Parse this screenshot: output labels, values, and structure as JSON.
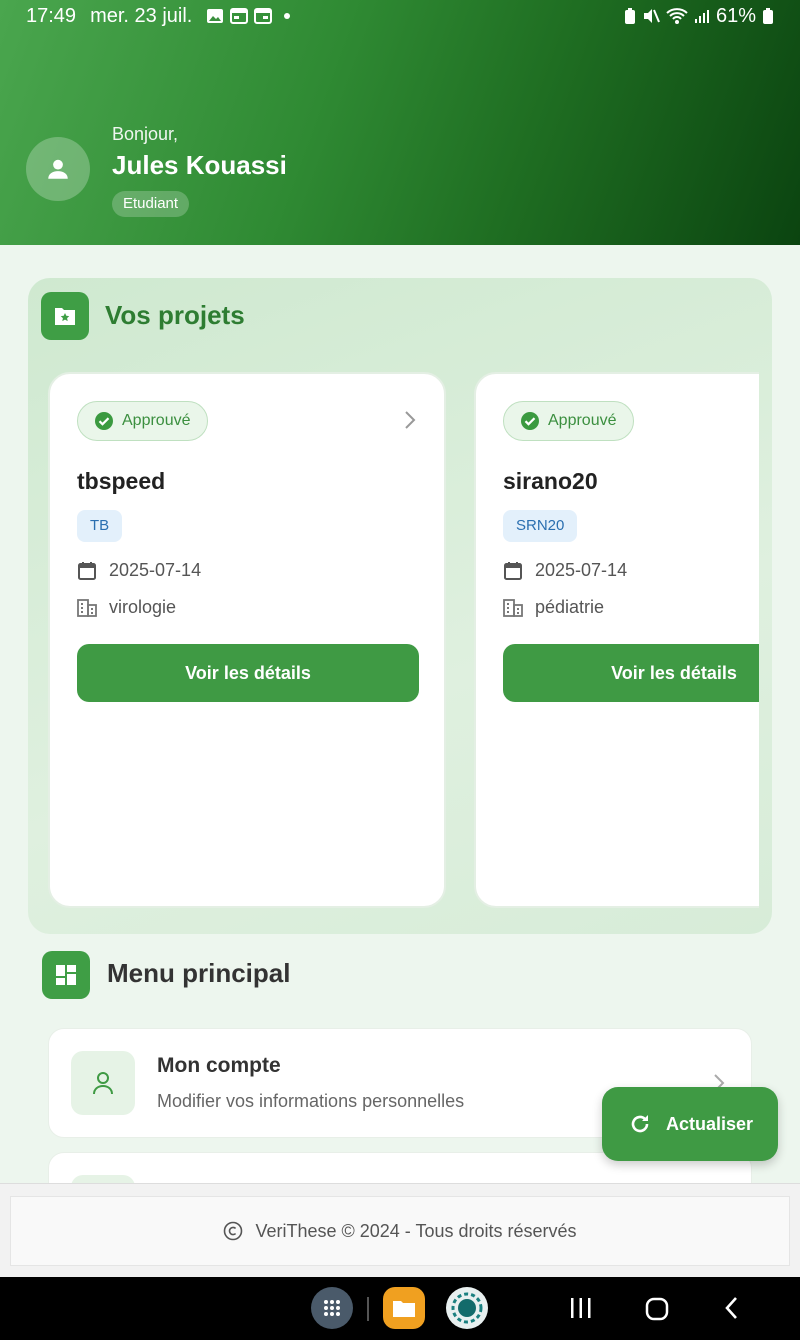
{
  "status_bar": {
    "time": "17:49",
    "date": "mer. 23 juil.",
    "battery": "61%"
  },
  "header": {
    "greeting": "Bonjour,",
    "user_name": "Jules Kouassi",
    "role": "Etudiant"
  },
  "projects": {
    "title": "Vos projets",
    "items": [
      {
        "status": "Approuvé",
        "name": "tbspeed",
        "code": "TB",
        "date": "2025-07-14",
        "department": "virologie",
        "button": "Voir les détails"
      },
      {
        "status": "Approuvé",
        "name": "sirano20",
        "code": "SRN20",
        "date": "2025-07-14",
        "department": "pédiatrie",
        "button": "Voir les détails"
      }
    ]
  },
  "menu": {
    "title": "Menu principal",
    "items": [
      {
        "title": "Mon compte",
        "subtitle": "Modifier vos informations personnelles"
      }
    ]
  },
  "fab": {
    "label": "Actualiser"
  },
  "footer": {
    "text": "VeriThese © 2024 - Tous droits réservés"
  },
  "colors": {
    "primary": "#3f9a44",
    "primary_dark": "#0b4410",
    "status_green": "#3b8f3f",
    "code_blue": "#2a6fb0"
  },
  "icons": [
    "person-icon",
    "folder-star-icon",
    "check-circle-icon",
    "chevron-right-icon",
    "calendar-icon",
    "building-icon",
    "dashboard-icon",
    "refresh-icon",
    "copyright-icon"
  ]
}
